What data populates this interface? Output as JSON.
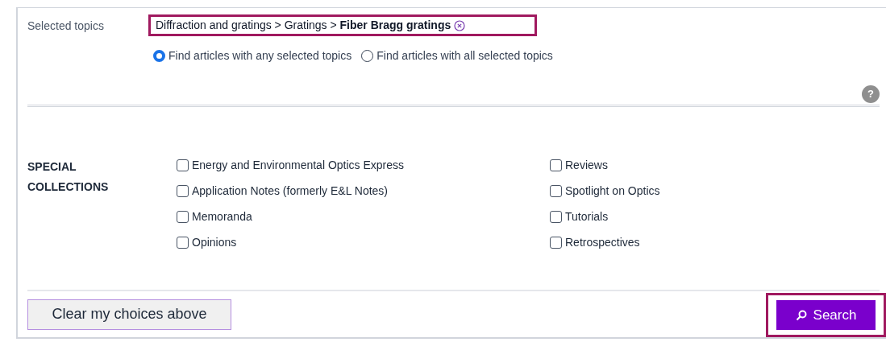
{
  "selected_topics": {
    "label": "Selected topics",
    "topic": "Diffraction and gratings > Gratings > **Fiber Bragg gratings**",
    "highlighted": true,
    "match_options": [
      {
        "label": "Find articles with any selected topics",
        "selected": true
      },
      {
        "label": "Find articles with all selected topics",
        "selected": false
      }
    ],
    "help": "?"
  },
  "special_collections": {
    "label": "SPECIAL COLLECTIONS",
    "columns": [
      [
        {
          "label": "Energy and Environmental Optics Express",
          "checked": false
        },
        {
          "label": "Application Notes (formerly E&L Notes)",
          "checked": false
        },
        {
          "label": "Memoranda",
          "checked": false
        },
        {
          "label": "Opinions",
          "checked": false
        }
      ],
      [
        {
          "label": "Reviews",
          "checked": false
        },
        {
          "label": "Spotlight on Optics",
          "checked": false
        },
        {
          "label": "Tutorials",
          "checked": false
        },
        {
          "label": "Retrospectives",
          "checked": false
        }
      ]
    ]
  },
  "footer": {
    "clear_button": "Clear my choices above",
    "search_button": {
      "label": "Search",
      "highlighted": true
    }
  }
}
